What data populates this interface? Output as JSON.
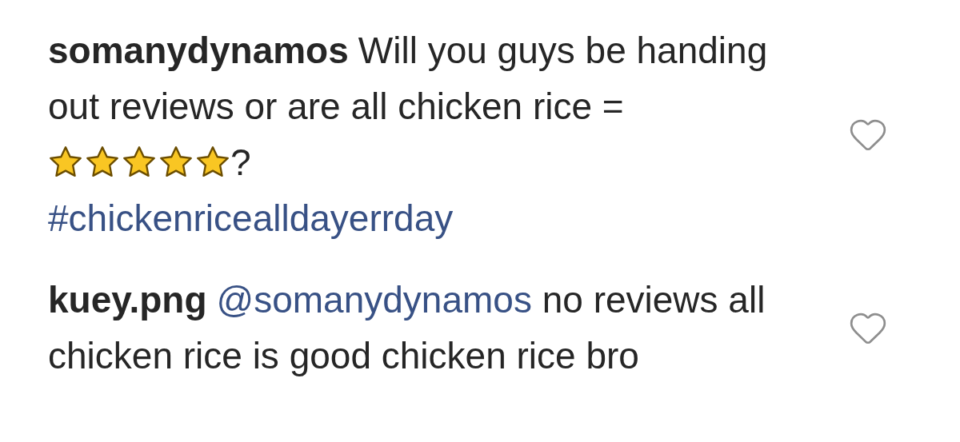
{
  "comments": [
    {
      "username": "somanydynamos",
      "liked": false,
      "segments": [
        {
          "kind": "text",
          "text": "Will you guys be handing out reviews or are all chicken rice = "
        },
        {
          "kind": "stars",
          "stars": 5
        },
        {
          "kind": "text",
          "text": "?"
        },
        {
          "kind": "break"
        },
        {
          "kind": "link",
          "text": "#chickenricealldayerrday"
        }
      ]
    },
    {
      "username": "kuey.png",
      "liked": false,
      "segments": [
        {
          "kind": "link",
          "text": "@somanydynamos"
        },
        {
          "kind": "text",
          "text": " no reviews all chicken rice is good chicken rice bro"
        }
      ]
    }
  ]
}
